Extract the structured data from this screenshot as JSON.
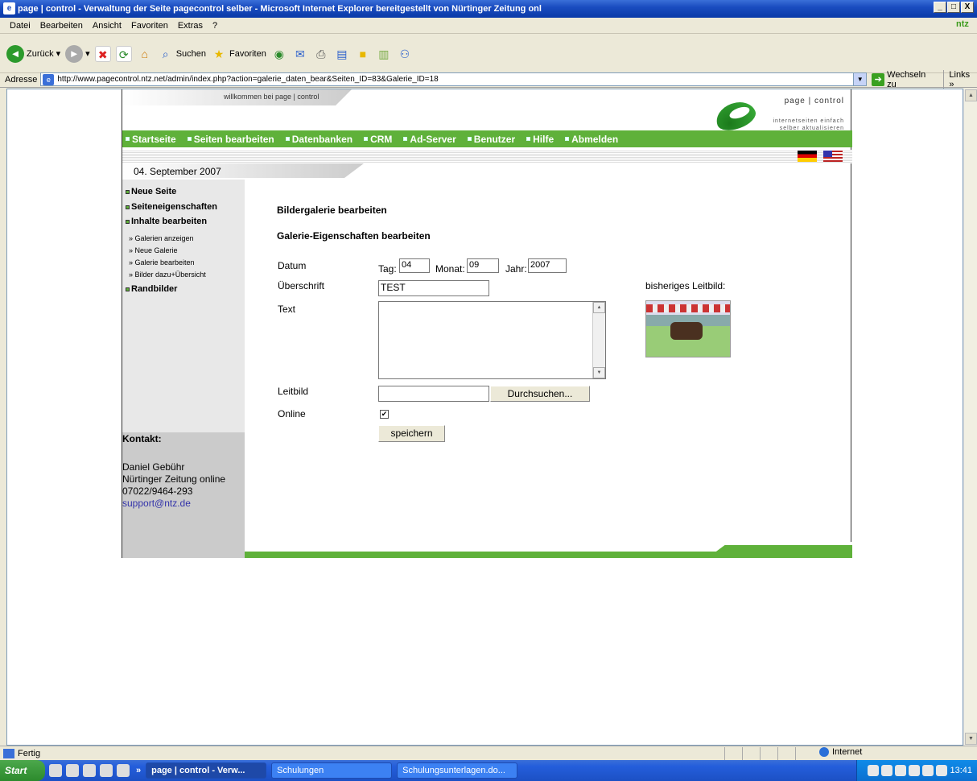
{
  "window": {
    "title": "page | control - Verwaltung der Seite pagecontrol selber - Microsoft Internet Explorer bereitgestellt von Nürtinger Zeitung onl",
    "min": "_",
    "max": "□",
    "close": "X"
  },
  "menu": [
    "Datei",
    "Bearbeiten",
    "Ansicht",
    "Favoriten",
    "Extras",
    "?"
  ],
  "brand": "ntz",
  "toolbar": {
    "back": "Zurück",
    "search": "Suchen",
    "favorites": "Favoriten"
  },
  "address": {
    "label": "Adresse",
    "url": "http://www.pagecontrol.ntz.net/admin/index.php?action=galerie_daten_bear&Seiten_ID=83&Galerie_ID=18",
    "go": "Wechseln zu",
    "links": "Links"
  },
  "page": {
    "welcome": "willkommen bei page | control",
    "logo_name": "page | control",
    "logo_tag1": "internetseiten einfach",
    "logo_tag2": "selber aktualisieren",
    "nav": [
      "Startseite",
      "Seiten bearbeiten",
      "Datenbanken",
      "CRM",
      "Ad-Server",
      "Benutzer",
      "Hilfe",
      "Abmelden"
    ],
    "date": "04. September 2007",
    "sidebar": {
      "neue_seite": "Neue Seite",
      "seiteneigenschaften": "Seiteneigenschaften",
      "inhalte": "Inhalte bearbeiten",
      "sub": [
        "» Galerien anzeigen",
        "» Neue Galerie",
        "» Galerie bearbeiten",
        "» Bilder dazu+Übersicht"
      ],
      "randbilder": "Randbilder"
    },
    "contact": {
      "heading": "Kontakt:",
      "name": "Daniel Gebühr",
      "org": "Nürtinger Zeitung online",
      "phone": "07022/9464-293",
      "email": "support@ntz.de"
    },
    "form": {
      "heading1": "Bildergalerie bearbeiten",
      "heading2": "Galerie-Eigenschaften bearbeiten",
      "datum_label": "Datum",
      "tag_label": "Tag:",
      "tag_value": "04",
      "monat_label": "Monat:",
      "monat_value": "09",
      "jahr_label": "Jahr:",
      "jahr_value": "2007",
      "ueberschrift_label": "Überschrift",
      "ueberschrift_value": "TEST",
      "text_label": "Text",
      "leitbild_label": "Leitbild",
      "browse": "Durchsuchen...",
      "online_label": "Online",
      "online_checked": true,
      "save": "speichern",
      "current_image_label": "bisheriges Leitbild:"
    }
  },
  "status": {
    "text": "Fertig",
    "zone": "Internet"
  },
  "taskbar": {
    "start": "Start",
    "tasks": [
      "page | control - Verw...",
      "Schulungen",
      "Schulungsunterlagen.do..."
    ],
    "clock": "13:41"
  }
}
